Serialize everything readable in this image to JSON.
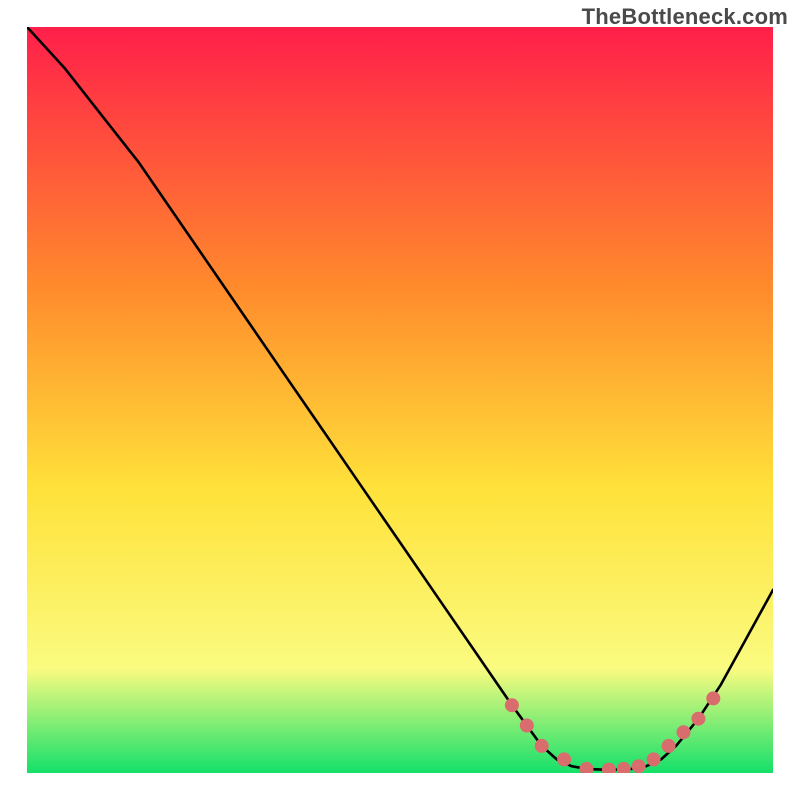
{
  "watermark": "TheBottleneck.com",
  "colors": {
    "gradient_top": "#ff1f4a",
    "gradient_mid1": "#ff8b2c",
    "gradient_mid2": "#ffe23a",
    "gradient_mid3": "#fafb80",
    "gradient_bottom": "#14e06a",
    "curve": "#000000",
    "marker_fill": "#d96d6d",
    "marker_stroke": "#7a2f2f"
  },
  "chart_data": {
    "type": "line",
    "title": "",
    "xlabel": "",
    "ylabel": "",
    "xlim": [
      0,
      100
    ],
    "ylim": [
      0,
      110
    ],
    "curve": {
      "x": [
        0,
        5,
        10,
        15,
        20,
        25,
        30,
        35,
        40,
        45,
        50,
        55,
        60,
        65,
        69,
        71,
        73,
        75,
        77,
        79,
        81,
        83,
        85,
        87,
        90,
        93,
        96,
        100
      ],
      "y": [
        110,
        104,
        97,
        90,
        82,
        74,
        66,
        58,
        50,
        42,
        34,
        26,
        18,
        10,
        4,
        2,
        1,
        0.6,
        0.5,
        0.5,
        0.6,
        1,
        2,
        4,
        8,
        13,
        19,
        27
      ]
    },
    "markers": {
      "x": [
        65,
        67,
        69,
        72,
        75,
        78,
        80,
        82,
        84,
        86,
        88,
        90,
        92
      ],
      "y": [
        10,
        7,
        4,
        2,
        0.6,
        0.5,
        0.6,
        1,
        2,
        4,
        6,
        8,
        11
      ]
    }
  }
}
